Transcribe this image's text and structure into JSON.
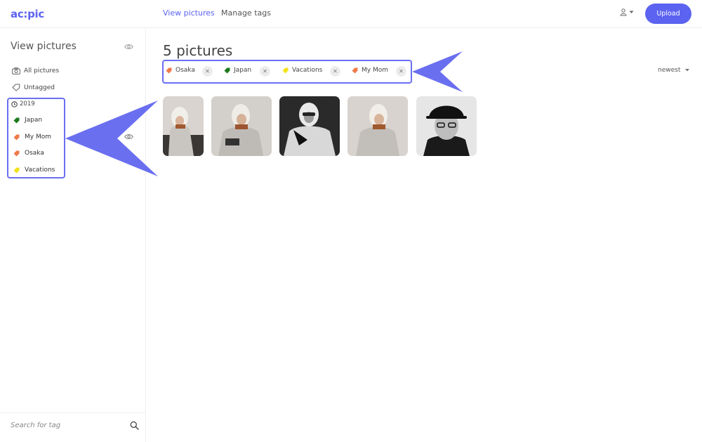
{
  "header": {
    "logo": "ac:pic",
    "nav": [
      {
        "label": "View pictures",
        "active": true
      },
      {
        "label": "Manage tags",
        "active": false
      }
    ],
    "upload_label": "Upload"
  },
  "sidebar": {
    "title": "View pictures",
    "items": [
      {
        "label": "All pictures",
        "icon": "camera-icon"
      },
      {
        "label": "Untagged",
        "icon": "tag-icon"
      }
    ],
    "year": "2019",
    "tags": [
      {
        "label": "Japan",
        "color": "#1a7a1a"
      },
      {
        "label": "My Mom",
        "color": "#f07a4a"
      },
      {
        "label": "Osaka",
        "color": "#f07a4a"
      },
      {
        "label": "Vacations",
        "color": "#f2e21a"
      }
    ],
    "search_placeholder": "Search for tag"
  },
  "main": {
    "title": "5 pictures",
    "filters": [
      {
        "label": "Osaka",
        "color": "#f07a4a"
      },
      {
        "label": "Japan",
        "color": "#1a7a1a"
      },
      {
        "label": "Vacations",
        "color": "#f2e21a"
      },
      {
        "label": "My Mom",
        "color": "#f07a4a"
      }
    ],
    "sort": "newest",
    "photo_count": 5
  },
  "colors": {
    "accent": "#5b63f0",
    "highlight": "#6a6ff0"
  }
}
